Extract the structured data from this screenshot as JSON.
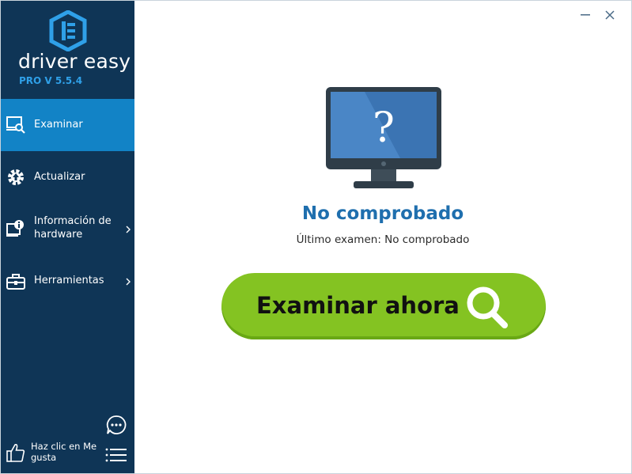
{
  "app": {
    "brand": "driver easy",
    "version": "PRO V 5.5.4"
  },
  "window_controls": {
    "minimize_icon": "minimize-icon",
    "close_icon": "close-icon"
  },
  "sidebar": {
    "items": [
      {
        "label": "Examinar",
        "icon": "scan-monitor-icon",
        "active": true
      },
      {
        "label": "Actualizar",
        "icon": "gear-upload-icon",
        "active": false
      },
      {
        "label": "Información de hardware",
        "icon": "hardware-info-icon",
        "active": false,
        "has_submenu": true
      },
      {
        "label": "Herramientas",
        "icon": "toolbox-icon",
        "active": false,
        "has_submenu": true
      }
    ],
    "like_text": "Haz clic en Me gusta",
    "chat_icon": "chat-icon",
    "menu_icon": "menu-icon",
    "like_icon": "thumbs-up-icon"
  },
  "main": {
    "status_title": "No comprobado",
    "last_scan": "Último examen: No comprobado",
    "scan_button_label": "Examinar ahora",
    "monitor_icon": "monitor-question-icon",
    "scan_button_icon": "search-icon"
  },
  "colors": {
    "sidebar_bg": "#0f3556",
    "active_item": "#1283c6",
    "version_text": "#2fa0e8",
    "status_title": "#1f6fae",
    "scan_button": "#84c322"
  }
}
